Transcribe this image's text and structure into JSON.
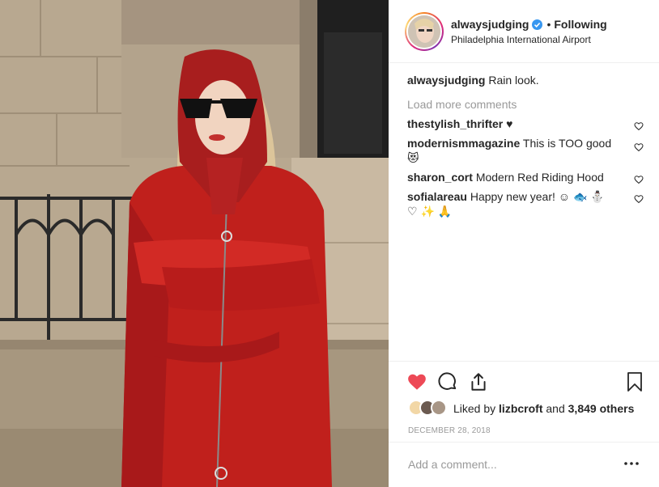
{
  "header": {
    "username": "alwaysjudging",
    "dot": "•",
    "follow_label": "Following",
    "location": "Philadelphia International Airport"
  },
  "caption": {
    "username": "alwaysjudging",
    "text": "Rain look."
  },
  "load_more_label": "Load more comments",
  "comments": [
    {
      "username": "thestylish_thrifter",
      "text": "♥"
    },
    {
      "username": "modernismmagazine",
      "text": "This is TOO good 😻"
    },
    {
      "username": "sharon_cort",
      "text": "Modern Red Riding Hood"
    },
    {
      "username": "sofialareau",
      "text": "Happy new year! ☺ 🐟 ⛄ ♡ ✨ 🙏"
    }
  ],
  "likes": {
    "prefix": "Liked by",
    "user": "lizbcroft",
    "and": "and",
    "others": "3,849 others"
  },
  "date": "DECEMBER 28, 2018",
  "add_comment_placeholder": "Add a comment...",
  "more_label": "•••",
  "colors": {
    "like_red": "#ed4956",
    "verified_blue": "#3897f0",
    "muted": "#999999",
    "text": "#262626"
  },
  "icons": [
    "heart-filled-icon",
    "comment-icon",
    "share-icon",
    "bookmark-icon",
    "verified-icon",
    "heart-outline-icon",
    "more-icon"
  ]
}
